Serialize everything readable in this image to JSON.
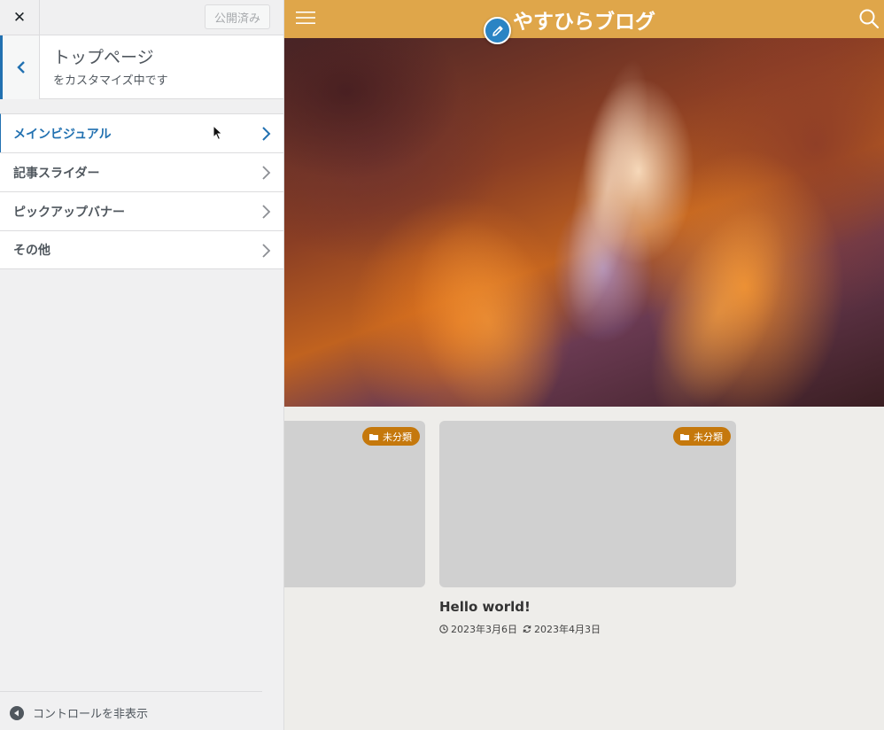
{
  "sidebar": {
    "close_label": "✕",
    "publish_label": "公開済み",
    "section": {
      "title": "トップページ",
      "subtitle": "をカスタマイズ中です"
    },
    "panels": [
      {
        "label": "メインビジュアル",
        "active": true
      },
      {
        "label": "記事スライダー",
        "active": false
      },
      {
        "label": "ピックアップバナー",
        "active": false
      },
      {
        "label": "その他",
        "active": false
      }
    ],
    "hide_controls_label": "コントロールを非表示"
  },
  "preview": {
    "site_title": "やすひらブログ",
    "header_color": "#dfa64a",
    "accent_color": "#c5780c",
    "cards": [
      {
        "category": "未分類"
      },
      {
        "category": "未分類",
        "title": "Hello world!",
        "published": "2023年3月6日",
        "updated": "2023年4月3日"
      }
    ]
  }
}
